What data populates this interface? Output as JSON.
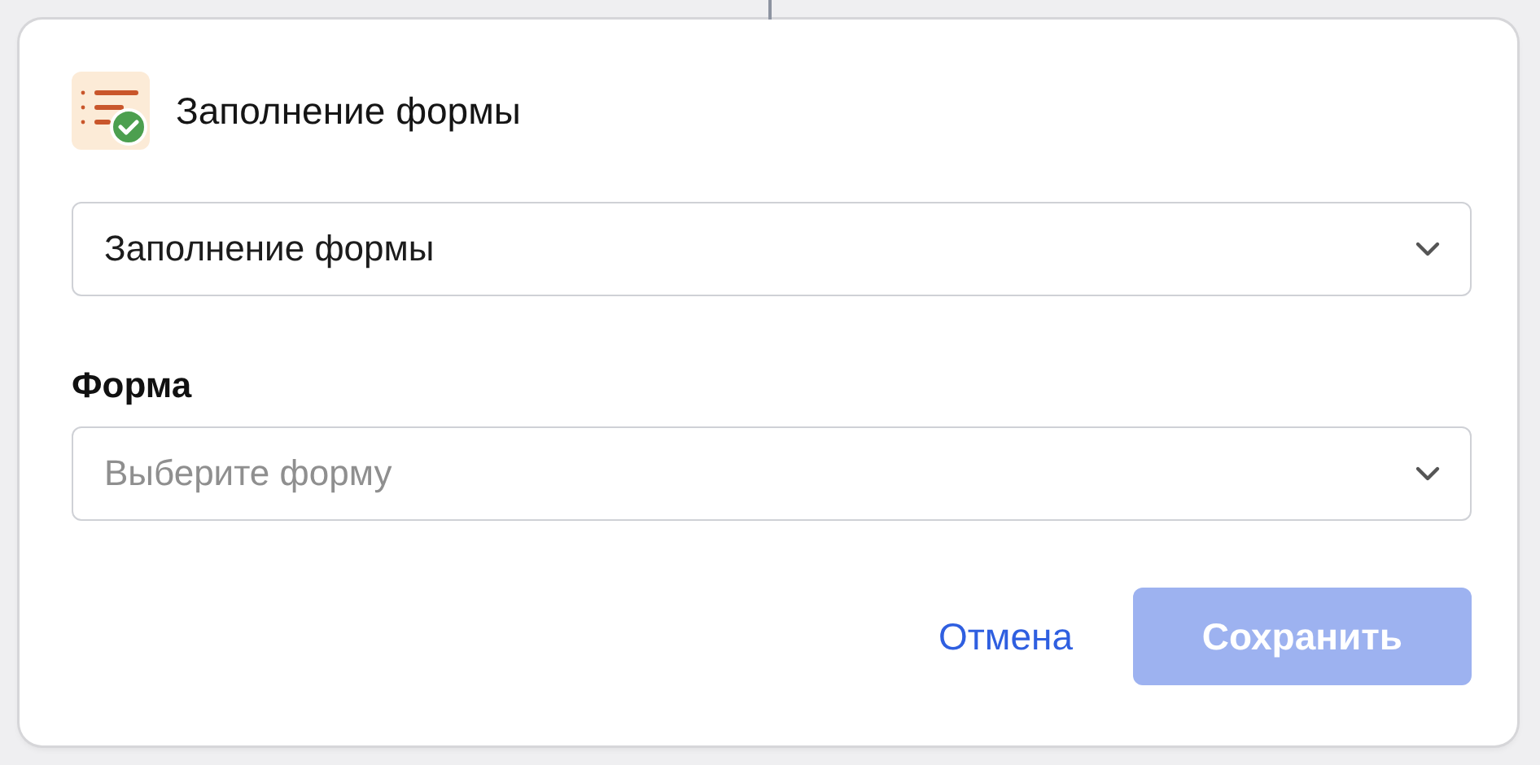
{
  "dialog": {
    "title": "Заполнение формы",
    "action_select": {
      "value": "Заполнение формы"
    },
    "form_field": {
      "label": "Форма",
      "placeholder": "Выберите форму"
    },
    "buttons": [
      {
        "kind": "link",
        "label": "Отмена",
        "disabled": false
      },
      {
        "kind": "primary",
        "label": "Сохранить",
        "disabled": true
      }
    ]
  }
}
